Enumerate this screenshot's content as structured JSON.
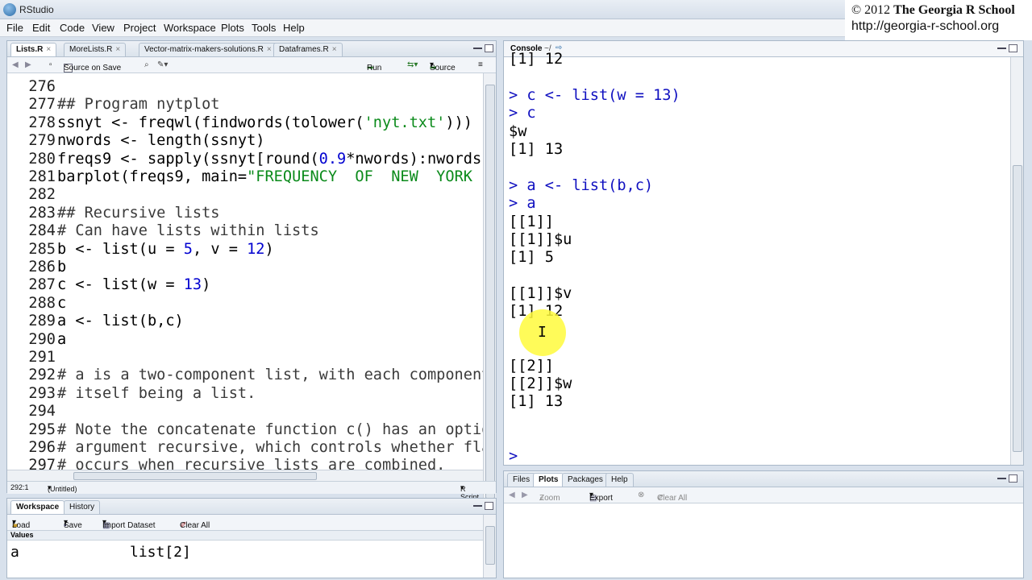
{
  "window": {
    "title": "RStudio"
  },
  "watermark": {
    "line1_prefix": "© 2012",
    "line1_name": "The Georgia R School",
    "line2": "http://georgia-r-school.org"
  },
  "menu": [
    "File",
    "Edit",
    "Code",
    "View",
    "Project",
    "Workspace",
    "Plots",
    "Tools",
    "Help"
  ],
  "editor": {
    "tabs": [
      "Lists.R",
      "MoreLists.R",
      "Vector-matrix-makers-solutions.R",
      "Dataframes.R"
    ],
    "toolbar": {
      "source_on_save": "Source on Save",
      "run": "Run",
      "source": "Source"
    },
    "lines": [
      {
        "n": "276",
        "parts": []
      },
      {
        "n": "277",
        "parts": [
          {
            "t": "## Program nytplot",
            "c": "cm"
          }
        ]
      },
      {
        "n": "278",
        "parts": [
          {
            "t": "ssnyt <- freqwl(findwords(tolower("
          },
          {
            "t": "'nyt.txt'",
            "c": "str"
          },
          {
            "t": ")))"
          }
        ]
      },
      {
        "n": "279",
        "parts": [
          {
            "t": "nwords <- length(ssnyt)"
          }
        ]
      },
      {
        "n": "280",
        "parts": [
          {
            "t": "freqs9 <- sapply(ssnyt[round("
          },
          {
            "t": "0.9",
            "c": "num"
          },
          {
            "t": "*nwords):nwords"
          }
        ]
      },
      {
        "n": "281",
        "parts": [
          {
            "t": "barplot(freqs9, main="
          },
          {
            "t": "\"FREQUENCY  OF  NEW  YORK",
            "c": "str"
          }
        ]
      },
      {
        "n": "282",
        "parts": []
      },
      {
        "n": "283",
        "parts": [
          {
            "t": "## Recursive lists",
            "c": "cm"
          }
        ]
      },
      {
        "n": "284",
        "parts": [
          {
            "t": "# Can have lists within lists",
            "c": "cm"
          }
        ]
      },
      {
        "n": "285",
        "parts": [
          {
            "t": "b <- list(u = "
          },
          {
            "t": "5",
            "c": "num"
          },
          {
            "t": ", v = "
          },
          {
            "t": "12",
            "c": "num"
          },
          {
            "t": ")"
          }
        ]
      },
      {
        "n": "286",
        "parts": [
          {
            "t": "b"
          }
        ]
      },
      {
        "n": "287",
        "parts": [
          {
            "t": "c <- list(w = "
          },
          {
            "t": "13",
            "c": "num"
          },
          {
            "t": ")"
          }
        ]
      },
      {
        "n": "288",
        "parts": [
          {
            "t": "c"
          }
        ]
      },
      {
        "n": "289",
        "parts": [
          {
            "t": "a <- list(b,c)"
          }
        ]
      },
      {
        "n": "290",
        "parts": [
          {
            "t": "a"
          }
        ]
      },
      {
        "n": "291",
        "parts": []
      },
      {
        "n": "292",
        "parts": [
          {
            "t": "# a is a two-component list, with each component",
            "c": "cm"
          }
        ]
      },
      {
        "n": "293",
        "parts": [
          {
            "t": "# itself being a list.",
            "c": "cm"
          }
        ]
      },
      {
        "n": "294",
        "parts": []
      },
      {
        "n": "295",
        "parts": [
          {
            "t": "# Note the concatenate function c() has an optio",
            "c": "cm"
          }
        ]
      },
      {
        "n": "296",
        "parts": [
          {
            "t": "# argument recursive, which controls whether fla",
            "c": "cm"
          }
        ]
      },
      {
        "n": "297",
        "parts": [
          {
            "t": "# occurs when recursive lists are combined.",
            "c": "cm"
          }
        ]
      }
    ],
    "status": {
      "position": "292:1",
      "scope": "(Untitled)",
      "filetype": "R Script"
    }
  },
  "console": {
    "title": "Console",
    "path": "~/",
    "lines": [
      {
        "t": "[1] 12",
        "k": "out"
      },
      {
        "t": "",
        "k": "out"
      },
      {
        "t": "> c <- list(w = 13)",
        "k": "prompt"
      },
      {
        "t": "> c",
        "k": "prompt"
      },
      {
        "t": "$w",
        "k": "out"
      },
      {
        "t": "[1] 13",
        "k": "out"
      },
      {
        "t": "",
        "k": "out"
      },
      {
        "t": "> a <- list(b,c)",
        "k": "prompt"
      },
      {
        "t": "> a",
        "k": "prompt"
      },
      {
        "t": "[[1]]",
        "k": "out"
      },
      {
        "t": "[[1]]$u",
        "k": "out"
      },
      {
        "t": "[1] 5",
        "k": "out"
      },
      {
        "t": "",
        "k": "out"
      },
      {
        "t": "[[1]]$v",
        "k": "out"
      },
      {
        "t": "[1] 12",
        "k": "out"
      },
      {
        "t": "",
        "k": "out"
      },
      {
        "t": "",
        "k": "out"
      },
      {
        "t": "[[2]]",
        "k": "out"
      },
      {
        "t": "[[2]]$w",
        "k": "out"
      },
      {
        "t": "[1] 13",
        "k": "out"
      },
      {
        "t": "",
        "k": "out"
      },
      {
        "t": "",
        "k": "out"
      },
      {
        "t": "> ",
        "k": "prompt"
      }
    ]
  },
  "workspace": {
    "tabs": [
      "Workspace",
      "History"
    ],
    "toolbar": {
      "load": "Load",
      "save": "Save",
      "import": "Import Dataset",
      "clear": "Clear All"
    },
    "section": "Values",
    "rows": [
      {
        "name": "a",
        "value": "list[2]"
      }
    ]
  },
  "files": {
    "tabs": [
      "Files",
      "Plots",
      "Packages",
      "Help"
    ],
    "toolbar": {
      "zoom": "Zoom",
      "export": "Export",
      "clear": "Clear All"
    }
  }
}
